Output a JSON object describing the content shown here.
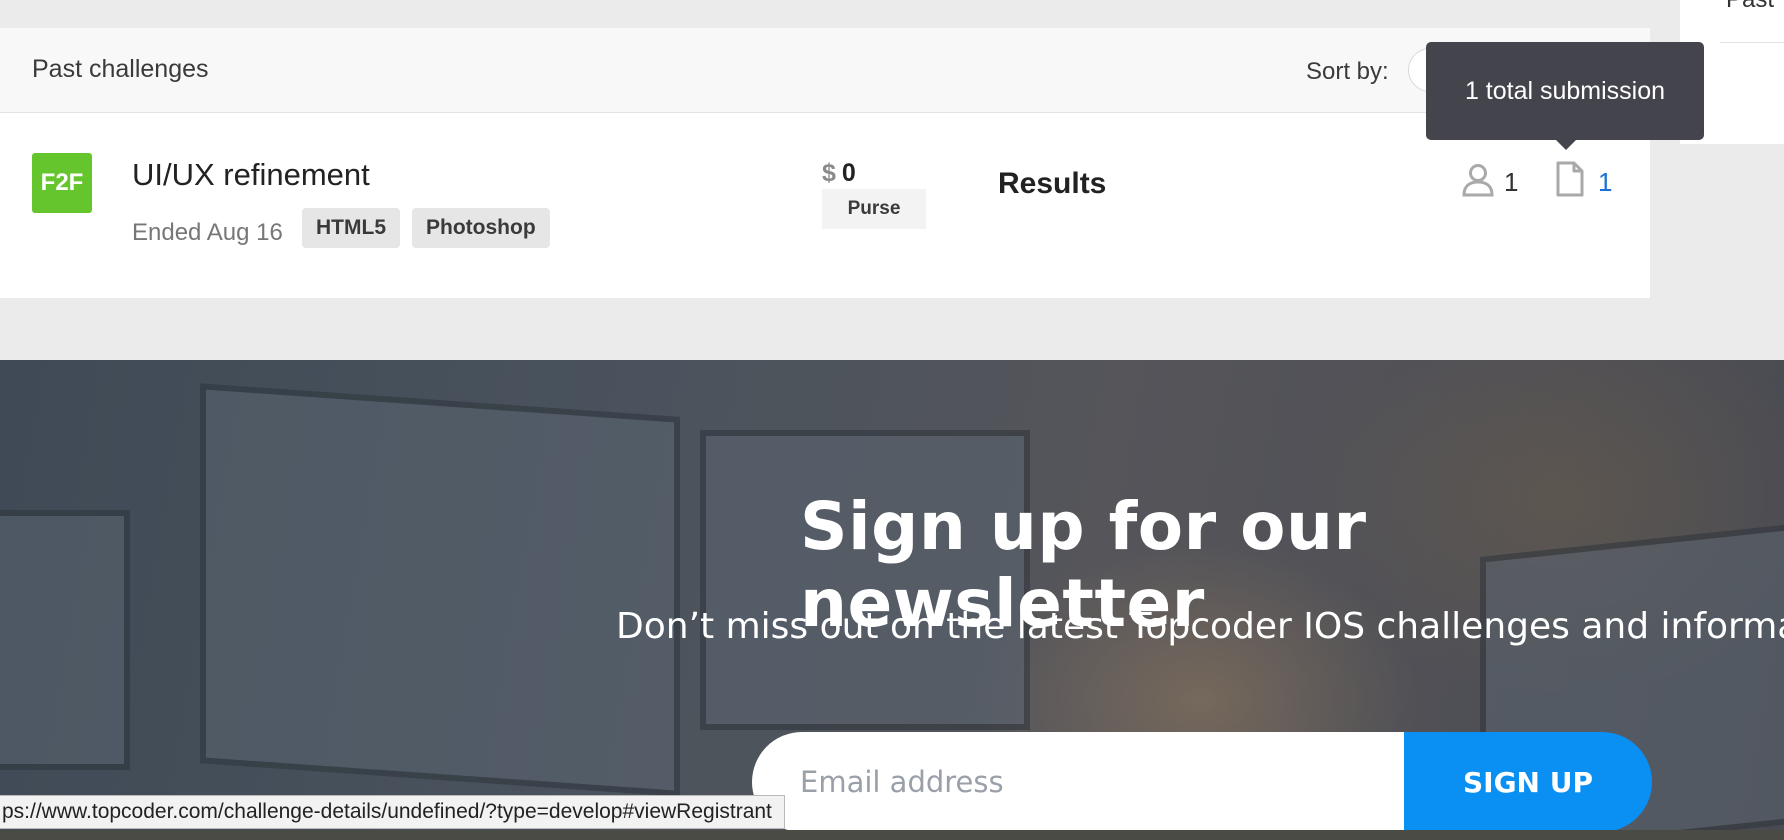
{
  "header": {
    "title": "Past challenges",
    "sort_label": "Sort by:"
  },
  "challenge": {
    "badge": "F2F",
    "title": "UI/UX refinement",
    "ended": "Ended Aug 16",
    "tags": [
      "HTML5",
      "Photoshop"
    ],
    "purse_currency": "$",
    "purse_amount": "0",
    "purse_label": "Purse",
    "results_label": "Results",
    "registrants": "1",
    "submissions": "1"
  },
  "tooltip": {
    "text": "1 total submission"
  },
  "side_panel": {
    "title": "Past"
  },
  "newsletter": {
    "title": "Sign up for our newsletter",
    "subtitle": "Don’t miss out on the latest Topcoder IOS challenges and information!",
    "email_placeholder": "Email address",
    "button_label": "SIGN UP"
  },
  "status_bar": {
    "url": "ps://www.topcoder.com/challenge-details/undefined/?type=develop#viewRegistrant"
  },
  "colors": {
    "badge_green": "#65c52c",
    "link_blue": "#1a6fd8",
    "signup_blue": "#0a8ff3",
    "tooltip_bg": "#44444c"
  }
}
